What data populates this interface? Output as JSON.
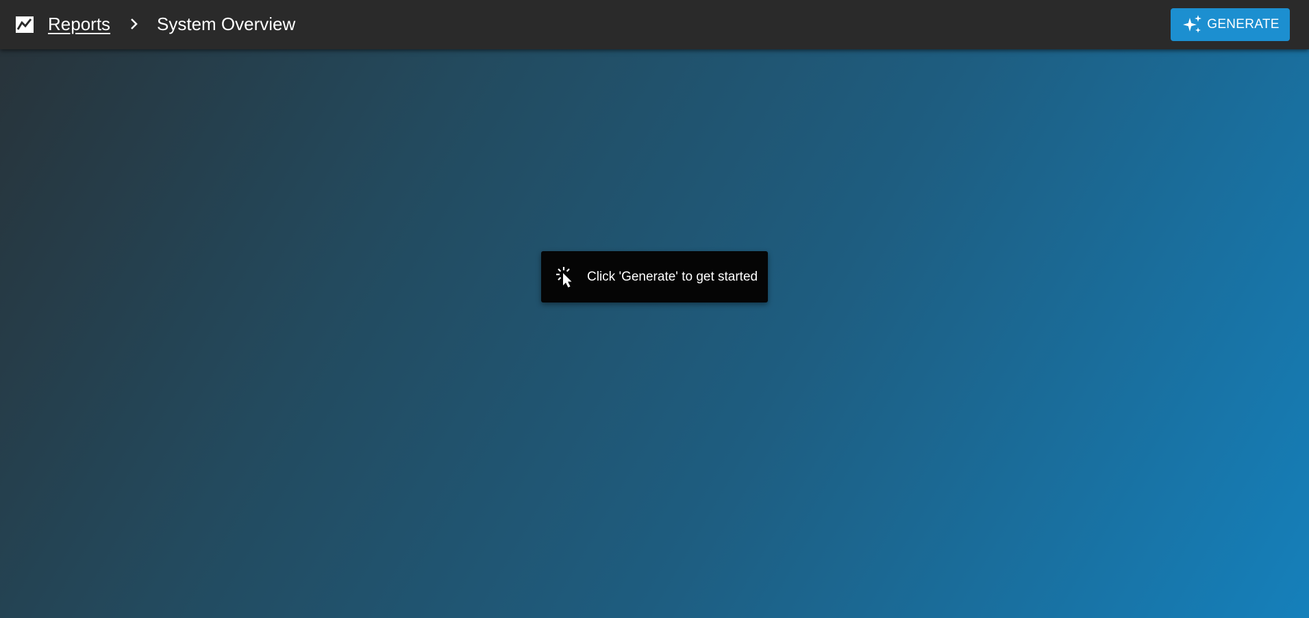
{
  "header": {
    "app_icon": "show-chart-icon",
    "breadcrumb": {
      "parent": "Reports",
      "separator_icon": "chevron-right-icon",
      "current": "System Overview"
    },
    "generate_button": {
      "label": "GENERATE",
      "icon": "sparkles-icon",
      "color": "#1c8fd0"
    }
  },
  "main": {
    "empty_state": {
      "icon": "click-cursor-icon",
      "message": "Click 'Generate' to get started"
    }
  },
  "colors": {
    "topbar": "#2a2a2a",
    "accent": "#1c8fd0",
    "toast": "#050505"
  }
}
